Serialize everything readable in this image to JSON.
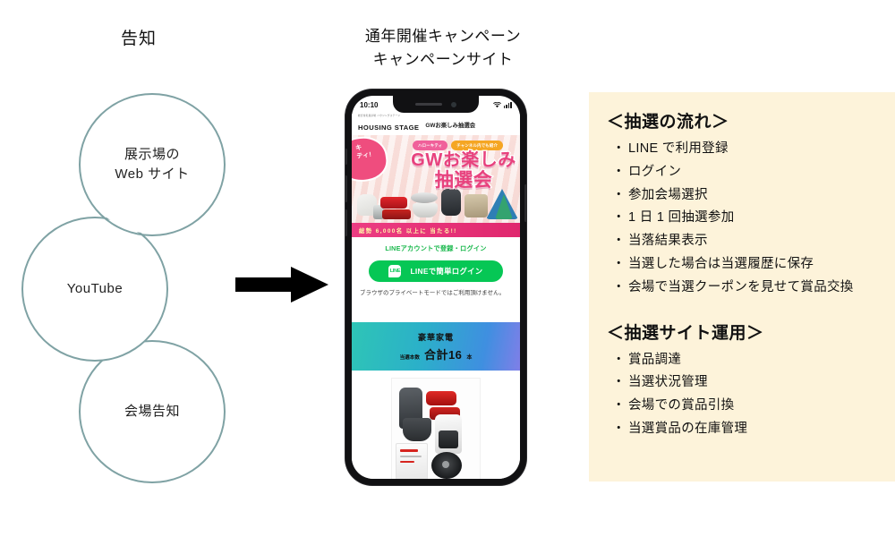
{
  "left_group": {
    "title": "告知",
    "circles": [
      {
        "id": "web",
        "label": "展示場の\nWeb サイト"
      },
      {
        "id": "youtube",
        "label": "YouTube"
      },
      {
        "id": "venue",
        "label": "会場告知"
      }
    ]
  },
  "arrow": {
    "name": "right-arrow",
    "color": "#000000"
  },
  "phone": {
    "caption": "通年開催キャンペーン\nキャンペーンサイト",
    "status_bar": {
      "time": "10:10",
      "wifi_icon": "wifi-icon",
      "signal_icon": "signal-bars-icon"
    },
    "app_header": {
      "brand_sub": "総合住宅展示場 ハウジングステージ",
      "brand_main": "HOUSING STAGE",
      "page_name": "GWお楽しみ抽選会"
    },
    "hero": {
      "badge_pink": "ハローキティ",
      "badge_orange": "チャンネル内でも紹介",
      "title_line1": "GWお楽しみ",
      "title_line2": "抽選会",
      "kitty_text": "キ\nティ!",
      "bottom_strip": "総勢 6,000名 以上に 当たる!!"
    },
    "line_block": {
      "lead": "LINEアカウントで登録・ログイン",
      "logo_text": "LINE",
      "button_label": "LINEで簡単ログイン",
      "note": "ブラウザのプライベートモードではご利用頂けません。"
    },
    "prize_band": {
      "title": "豪華家電",
      "count_label": "当選本数",
      "count_value": "合計16",
      "count_unit": "本"
    },
    "photo": {
      "alt_name": "prize-appliances-photo"
    }
  },
  "panel": {
    "section1": {
      "heading": "＜抽選の流れ＞",
      "items": [
        "LINE で利用登録",
        "ログイン",
        "参加会場選択",
        "1 日 1 回抽選参加",
        "当落結果表示",
        "当選した場合は当選履歴に保存",
        "会場で当選クーポンを見せて賞品交換"
      ]
    },
    "section2": {
      "heading": "＜抽選サイト運用＞",
      "items": [
        "賞品調達",
        "当選状況管理",
        "会場での賞品引換",
        "当選賞品の在庫管理"
      ]
    }
  },
  "colors": {
    "circle_stroke": "#7fa2a4",
    "panel_bg": "#fdf3da",
    "line_green": "#06c755",
    "hero_pink": "#e8427e",
    "band_gradient_start": "#2ec5b6",
    "band_gradient_end": "#7f7fe8"
  }
}
